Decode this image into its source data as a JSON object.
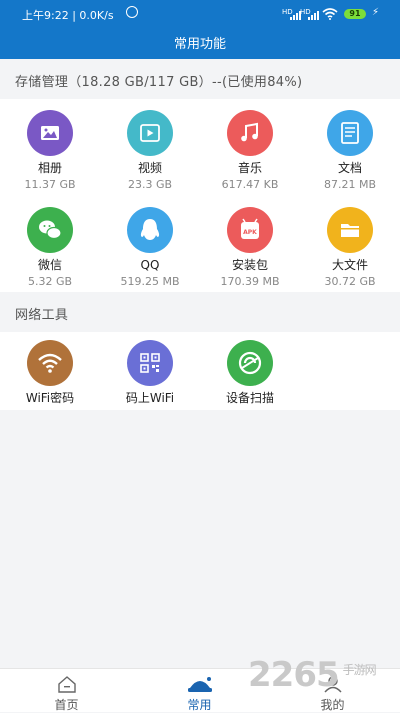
{
  "status_bar": {
    "time_text": "上午9:22 | 0.0K/s",
    "signal1": "HD",
    "signal2": "HD",
    "battery": "91"
  },
  "header": {
    "title": "常用功能"
  },
  "storage": {
    "heading": "存储管理（18.28 GB/117 GB）--(已使用84%)",
    "items": [
      {
        "label": "相册",
        "size": "11.37 GB",
        "color": "#7a58c5",
        "icon": "photo-icon"
      },
      {
        "label": "视频",
        "size": "23.3 GB",
        "color": "#44b9c9",
        "icon": "video-icon"
      },
      {
        "label": "音乐",
        "size": "617.47 KB",
        "color": "#ec5b5b",
        "icon": "music-icon"
      },
      {
        "label": "文档",
        "size": "87.21 MB",
        "color": "#3fa6e8",
        "icon": "document-icon"
      },
      {
        "label": "微信",
        "size": "5.32 GB",
        "color": "#3db04e",
        "icon": "wechat-icon"
      },
      {
        "label": "QQ",
        "size": "519.25 MB",
        "color": "#3fa6e8",
        "icon": "qq-icon"
      },
      {
        "label": "安装包",
        "size": "170.39 MB",
        "color": "#ec5b5b",
        "icon": "apk-icon"
      },
      {
        "label": "大文件",
        "size": "30.72 GB",
        "color": "#f1b31c",
        "icon": "folder-icon"
      }
    ]
  },
  "network": {
    "heading": "网络工具",
    "items": [
      {
        "label": "WiFi密码",
        "color": "#b0723a",
        "icon": "wifi-icon"
      },
      {
        "label": "码上WiFi",
        "color": "#6a6fd6",
        "icon": "qrcode-icon"
      },
      {
        "label": "设备扫描",
        "color": "#3db04e",
        "icon": "scan-icon"
      }
    ]
  },
  "tabbar": {
    "tabs": [
      {
        "label": "首页"
      },
      {
        "label": "常用"
      },
      {
        "label": "我的"
      }
    ],
    "active_index": 1
  },
  "watermark": {
    "text": "2265",
    "sub": "手游网"
  }
}
